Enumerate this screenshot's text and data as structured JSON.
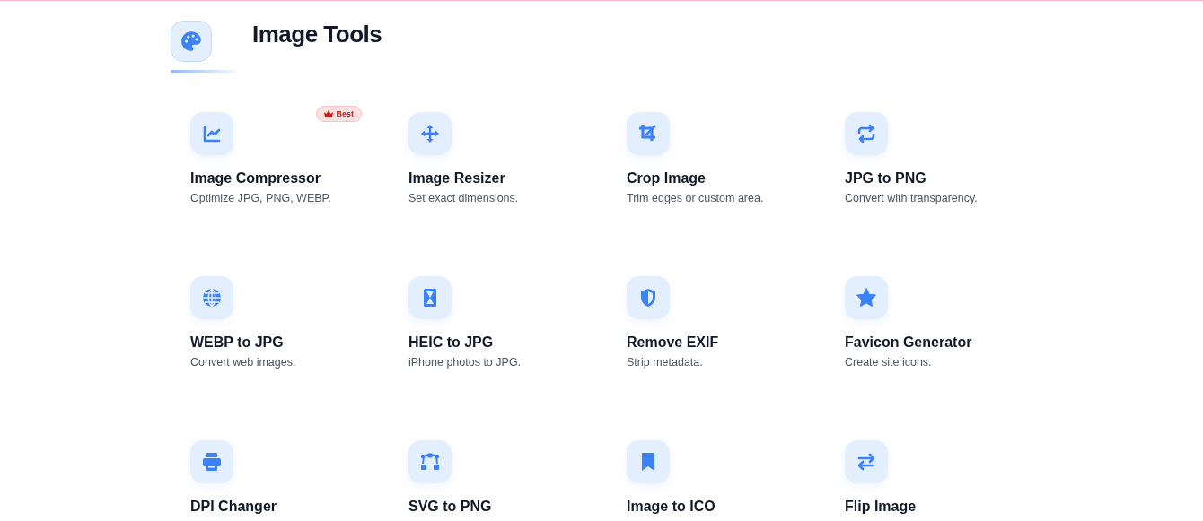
{
  "header": {
    "title": "Image Tools"
  },
  "tools": [
    {
      "title": "Image Compressor",
      "description": "Optimize JPG, PNG, WEBP.",
      "badge": "Best"
    },
    {
      "title": "Image Resizer",
      "description": "Set exact dimensions."
    },
    {
      "title": "Crop Image",
      "description": "Trim edges or custom area."
    },
    {
      "title": "JPG to PNG",
      "description": "Convert with transparency."
    },
    {
      "title": "WEBP to JPG",
      "description": "Convert web images."
    },
    {
      "title": "HEIC to JPG",
      "description": "iPhone photos to JPG."
    },
    {
      "title": "Remove EXIF",
      "description": "Strip metadata."
    },
    {
      "title": "Favicon Generator",
      "description": "Create site icons."
    },
    {
      "title": "DPI Changer"
    },
    {
      "title": "SVG to PNG"
    },
    {
      "title": "Image to ICO"
    },
    {
      "title": "Flip Image"
    }
  ]
}
